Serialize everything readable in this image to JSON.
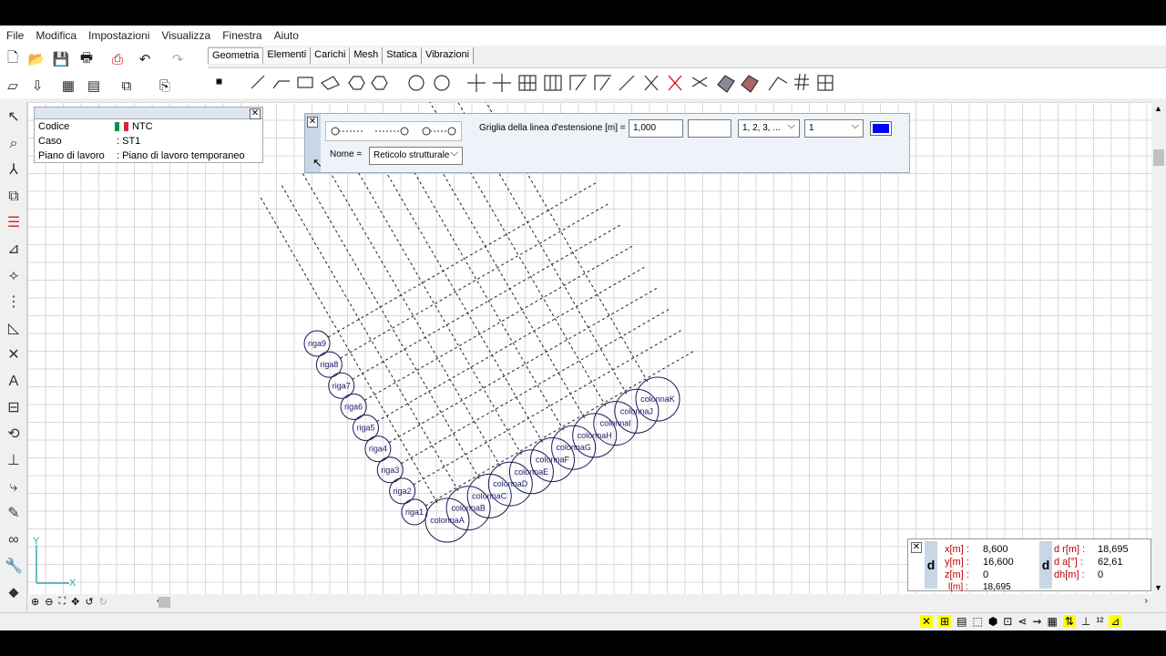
{
  "menu": [
    "File",
    "Modifica",
    "Impostazioni",
    "Visualizza",
    "Finestra",
    "Aiuto"
  ],
  "tabs": [
    "Geometria",
    "Elementi",
    "Carichi",
    "Mesh",
    "Statica",
    "Vibrazioni"
  ],
  "info_panel": {
    "rows": [
      {
        "key": "Codice",
        "value": "NTC"
      },
      {
        "key": "Caso",
        "value": ": ST1"
      },
      {
        "key": "Piano di lavoro",
        "value": ": Piano di lavoro temporaneo"
      }
    ]
  },
  "grid_panel": {
    "extension_label": "Griglia della linea d'estensione [m] =",
    "extension_value": "1,000",
    "blank_value": "",
    "numbering_select": "1, 2, 3, ...",
    "count_select": "1",
    "name_label": "Nome =",
    "name_select": "Reticolo strutturale",
    "color": "#0000ff"
  },
  "rows": [
    "riga1",
    "riga2",
    "riga3",
    "riga4",
    "riga5",
    "riga6",
    "riga7",
    "riga8",
    "riga9"
  ],
  "columns": [
    "colonnaA",
    "colonnaB",
    "colonnaC",
    "colonnaD",
    "colonnaE",
    "colonnaF",
    "colonnaG",
    "colonnaH",
    "colonnaI",
    "colonnaJ",
    "colonnaK"
  ],
  "axes": {
    "x": "X",
    "y": "Y"
  },
  "coords": {
    "x_label": "x[m] :",
    "x_value": "8,600",
    "y_label": "y[m] :",
    "y_value": "16,600",
    "z_label": "z[m] :",
    "z_value": "0",
    "l_label": "l[m] :",
    "l_value": "18,695",
    "dr_label": "d r[m] :",
    "dr_value": "18,695",
    "da_label": "d a[°] :",
    "da_value": "62,61",
    "dh_label": "dh[m] :",
    "dh_value": "0",
    "d_label": "d"
  }
}
